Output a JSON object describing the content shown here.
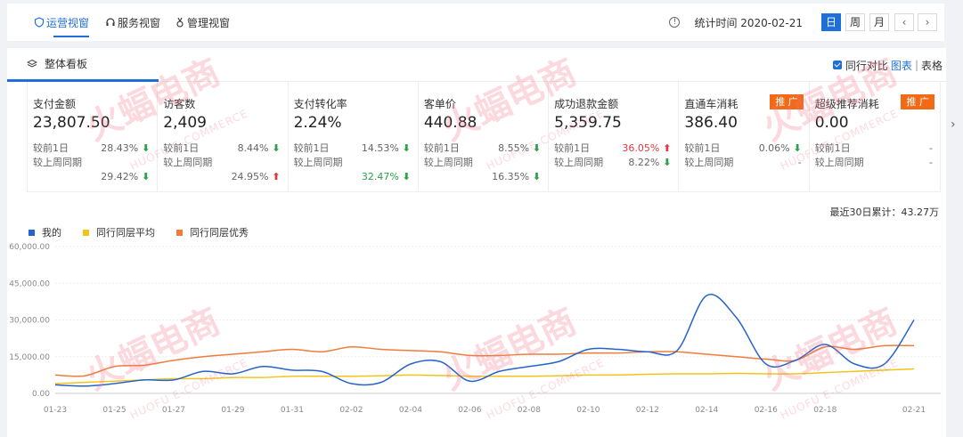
{
  "tabs": [
    {
      "label": "运营视窗",
      "icon": "shield-icon",
      "active": true
    },
    {
      "label": "服务视窗",
      "icon": "headset-icon",
      "active": false
    },
    {
      "label": "管理视窗",
      "icon": "medal-icon",
      "active": false
    }
  ],
  "stat_time": "统计时间 2020-02-21",
  "periods": [
    {
      "label": "日",
      "active": true
    },
    {
      "label": "周",
      "active": false
    },
    {
      "label": "月",
      "active": false
    }
  ],
  "section": {
    "title": "整体看板",
    "compare_label": "同行对比",
    "view_chart": "图表",
    "view_table": "表格"
  },
  "cards": [
    {
      "title": "支付金额",
      "value": "23,807.50",
      "badge": "",
      "r1_label": "较前1日",
      "r1_pct": "28.43%",
      "r1_dir": "down",
      "r2_label": "较上周同期",
      "r2_pct": "",
      "r2_dir": "",
      "r3_pct": "29.42%",
      "r3_dir": "down"
    },
    {
      "title": "访客数",
      "value": "2,409",
      "badge": "",
      "r1_label": "较前1日",
      "r1_pct": "8.44%",
      "r1_dir": "down",
      "r2_label": "较上周同期",
      "r2_pct": "",
      "r2_dir": "",
      "r3_pct": "24.95%",
      "r3_dir": "up"
    },
    {
      "title": "支付转化率",
      "value": "2.24%",
      "badge": "",
      "r1_label": "较前1日",
      "r1_pct": "14.53%",
      "r1_dir": "down",
      "r2_label": "较上周同期",
      "r2_pct": "",
      "r2_dir": "",
      "r3_pct": "32.47%",
      "r3_dir": "down",
      "r3_color": "green"
    },
    {
      "title": "客单价",
      "value": "440.88",
      "badge": "",
      "r1_label": "较前1日",
      "r1_pct": "8.55%",
      "r1_dir": "down",
      "r2_label": "较上周同期",
      "r2_pct": "",
      "r2_dir": "",
      "r3_pct": "16.35%",
      "r3_dir": "down"
    },
    {
      "title": "成功退款金额",
      "value": "5,359.75",
      "badge": "",
      "r1_label": "较前1日",
      "r1_pct": "36.05%",
      "r1_dir": "up",
      "r1_color": "red",
      "r2_label": "较上周同期",
      "r2_pct": "8.22%",
      "r2_dir": "down",
      "r3_pct": "",
      "r3_dir": ""
    },
    {
      "title": "直通车消耗",
      "value": "386.40",
      "badge": "推 广",
      "r1_label": "较前1日",
      "r1_pct": "0.06%",
      "r1_dir": "down",
      "r2_label": "较上周同期",
      "r2_pct": "-",
      "r2_dir": "",
      "r3_pct": "",
      "r3_dir": ""
    },
    {
      "title": "超级推荐消耗",
      "value": "0.00",
      "badge": "推 广",
      "r1_label": "较前1日",
      "r1_pct": "-",
      "r1_dir": "",
      "r2_label": "较上周同期",
      "r2_pct": "-",
      "r2_dir": "",
      "r3_pct": "",
      "r3_dir": ""
    }
  ],
  "total_label": "最近30日累计：43.27万",
  "watermark": {
    "brand": "火蝠电商",
    "sub": "HUOFU E-COMMERCE"
  },
  "colors": {
    "accent": "#1f6fd8",
    "my": "#2563c9",
    "avg": "#f0c419",
    "best": "#f07c3a",
    "up": "#e0393e",
    "down": "#2aa14a",
    "badge": "#f26a16"
  },
  "chart_data": {
    "type": "line",
    "x": [
      "01-23",
      "01-24",
      "01-25",
      "01-26",
      "01-27",
      "01-28",
      "01-29",
      "01-30",
      "01-31",
      "02-01",
      "02-02",
      "02-03",
      "02-04",
      "02-05",
      "02-06",
      "02-07",
      "02-08",
      "02-09",
      "02-10",
      "02-11",
      "02-12",
      "02-13",
      "02-14",
      "02-15",
      "02-16",
      "02-17",
      "02-18",
      "02-19",
      "02-20",
      "02-21"
    ],
    "x_ticks": [
      "01-23",
      "01-25",
      "01-27",
      "01-29",
      "01-31",
      "02-02",
      "02-04",
      "02-06",
      "02-08",
      "02-10",
      "02-12",
      "02-14",
      "02-16",
      "02-18",
      "02-21"
    ],
    "y_ticks": [
      "0.00",
      "15,000.00",
      "30,000.00",
      "45,000.00",
      "60,000.00"
    ],
    "ylim": [
      0,
      60000
    ],
    "legend_position": "top-left",
    "series": [
      {
        "name": "我的",
        "color": "#2563c9",
        "values": [
          3500,
          3000,
          4000,
          5500,
          5500,
          9000,
          8000,
          11000,
          9500,
          9000,
          4000,
          4500,
          12000,
          13000,
          5000,
          9000,
          11000,
          13000,
          18000,
          18000,
          17000,
          17500,
          40000,
          31000,
          12000,
          13500,
          20000,
          12000,
          12000,
          30000
        ]
      },
      {
        "name": "同行同层平均",
        "color": "#f0c419",
        "values": [
          4000,
          4500,
          5000,
          5500,
          6000,
          6000,
          6500,
          6500,
          7000,
          7000,
          7000,
          7200,
          7500,
          7300,
          7000,
          7000,
          7000,
          7200,
          7500,
          7500,
          7800,
          8000,
          8000,
          8200,
          8000,
          8000,
          8500,
          9000,
          9500,
          10000
        ]
      },
      {
        "name": "同行同层优秀",
        "color": "#f07c3a",
        "values": [
          7500,
          7200,
          11000,
          11500,
          13500,
          15000,
          16000,
          17000,
          18000,
          17000,
          19000,
          18000,
          17500,
          17000,
          15500,
          15500,
          16000,
          16000,
          16500,
          16500,
          17000,
          17000,
          16000,
          15000,
          14000,
          13500,
          19000,
          18000,
          19500,
          19500
        ]
      }
    ]
  }
}
